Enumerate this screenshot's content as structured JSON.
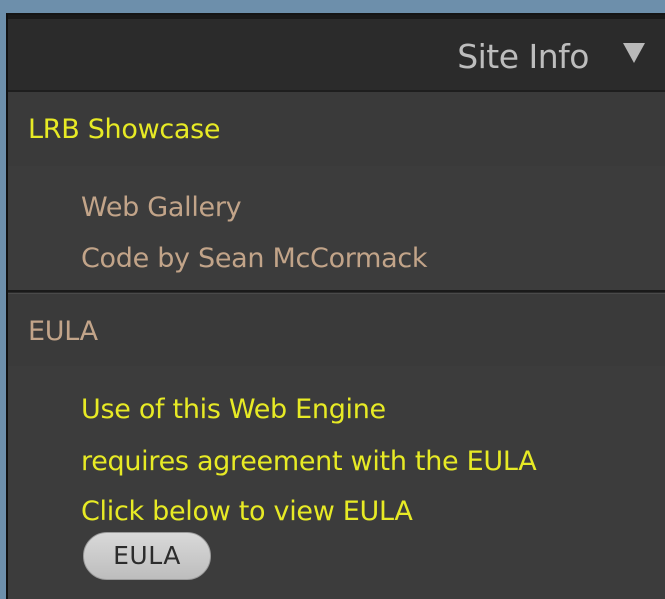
{
  "header": {
    "title": "Site Info",
    "toggle_icon": "triangle-down-icon"
  },
  "sections": [
    {
      "title": "LRB Showcase",
      "title_color": "#e7ea25",
      "lines": [
        "Web Gallery",
        "Code by Sean McCormack"
      ],
      "line_color": "#c2a489"
    },
    {
      "title": "EULA",
      "title_color": "#c2a489",
      "lines": [
        "Use of this Web Engine",
        "requires agreement with the EULA",
        "Click below to view EULA"
      ],
      "line_color": "#e7ea25",
      "button_label": "EULA"
    }
  ],
  "colors": {
    "background": "#6d8fab",
    "panel": "#2a2a2a",
    "section": "#3c3c3c",
    "accent_yellow": "#e7ea25",
    "muted_text": "#c2a489"
  }
}
